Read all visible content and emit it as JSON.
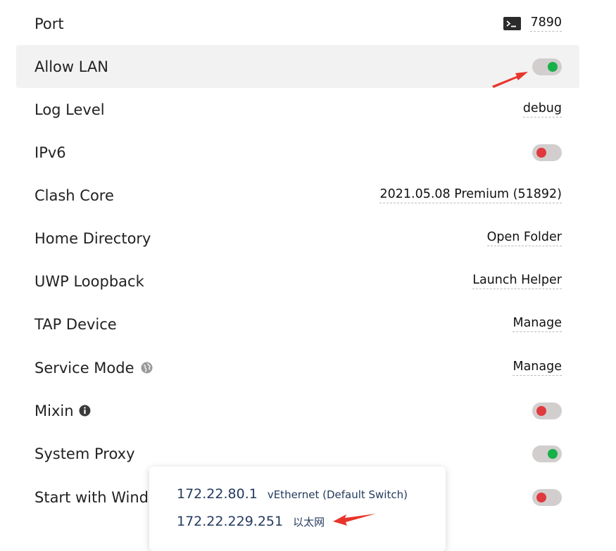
{
  "settings": [
    {
      "label": "Port",
      "control": "value",
      "value": "7890",
      "icon": "terminal-icon"
    },
    {
      "label": "Allow LAN",
      "control": "toggle",
      "state": "on"
    },
    {
      "label": "Log Level",
      "control": "value",
      "value": "debug"
    },
    {
      "label": "IPv6",
      "control": "toggle",
      "state": "off"
    },
    {
      "label": "Clash Core",
      "control": "value",
      "value": "2021.05.08 Premium (51892)"
    },
    {
      "label": "Home Directory",
      "control": "value",
      "value": "Open Folder"
    },
    {
      "label": "UWP Loopback",
      "control": "value",
      "value": "Launch Helper"
    },
    {
      "label": "TAP Device",
      "control": "value",
      "value": "Manage"
    },
    {
      "label": "Service Mode",
      "control": "value",
      "value": "Manage",
      "label_icon": "globe-icon"
    },
    {
      "label": "Mixin",
      "control": "toggle",
      "state": "off",
      "label_icon": "info-icon"
    },
    {
      "label": "System Proxy",
      "control": "toggle",
      "state": "on"
    },
    {
      "label": "Start with Wind",
      "control": "toggle",
      "state": "off"
    }
  ],
  "popup": {
    "entries": [
      {
        "ip": "172.22.80.1",
        "interface": "vEthernet (Default Switch)"
      },
      {
        "ip": "172.22.229.251",
        "interface": "以太网"
      }
    ]
  },
  "colors": {
    "toggle_on": "#18b04a",
    "toggle_off": "#e0393e",
    "toggle_track": "#d2cece",
    "annotation_arrow": "#e8352b"
  }
}
